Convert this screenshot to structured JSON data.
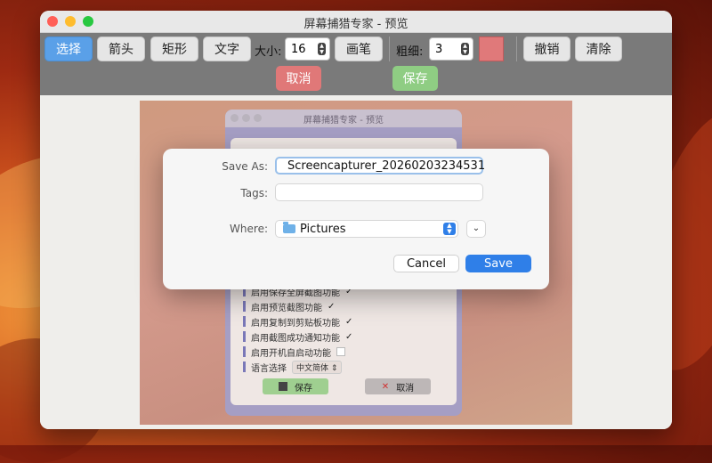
{
  "window": {
    "title": "屏幕捕猎专家 - 预览"
  },
  "toolbar": {
    "select_label": "选择",
    "arrow_label": "箭头",
    "rect_label": "矩形",
    "text_label": "文字",
    "size_label": "大小:",
    "size_value": "16",
    "pen_label": "画笔",
    "thickness_label": "粗细:",
    "thickness_value": "3",
    "color": "#e0797a",
    "undo_label": "撤销",
    "clear_label": "清除",
    "cancel_label": "取消",
    "save_label": "保存"
  },
  "inner_window": {
    "title": "屏幕捕猎专家 - 预览",
    "settings": [
      {
        "label": "启用保存全屏截图功能",
        "checked": true
      },
      {
        "label": "启用预览截图功能",
        "checked": true
      },
      {
        "label": "启用复制到剪贴板功能",
        "checked": true
      },
      {
        "label": "启用截图成功通知功能",
        "checked": true
      },
      {
        "label": "启用开机自启动功能",
        "checked": false
      }
    ],
    "language_label": "语言选择",
    "language_value": "中文简体",
    "save_label": "保存",
    "cancel_label": "取消"
  },
  "dialog": {
    "save_as_label": "Save As:",
    "save_as_value": "Screencapturer_20260203234531",
    "tags_label": "Tags:",
    "tags_value": "",
    "where_label": "Where:",
    "where_value": "Pictures",
    "cancel_label": "Cancel",
    "save_label": "Save"
  },
  "colors": {
    "accent": "#2f7fe8",
    "cancel_red": "#e07878",
    "save_green": "#8fcd83"
  }
}
